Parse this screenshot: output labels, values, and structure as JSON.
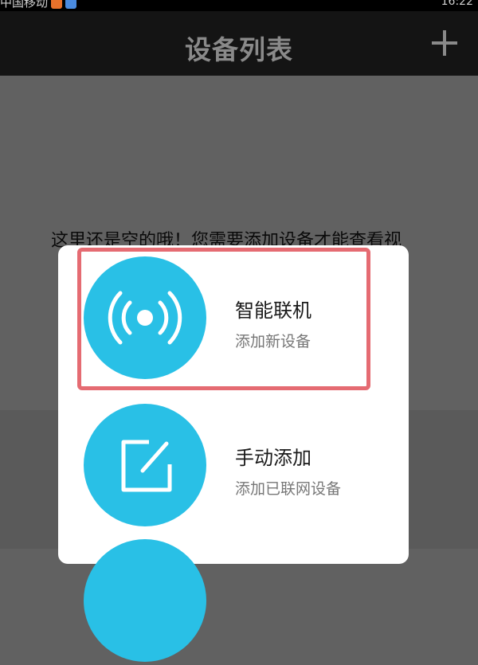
{
  "status_bar": {
    "left_text": "中国移动",
    "right_text": "16:22"
  },
  "header": {
    "title": "设备列表",
    "add_button": "plus-icon"
  },
  "main": {
    "empty_message": "这里还是空的哦！您需要添加设备才能查看视"
  },
  "dialog": {
    "options": [
      {
        "title": "智能联机",
        "subtitle": "添加新设备",
        "icon": "wireless-signal-icon"
      },
      {
        "title": "手动添加",
        "subtitle": "添加已联网设备",
        "icon": "edit-icon"
      },
      {
        "title": "",
        "subtitle": "",
        "icon": "circle-icon"
      }
    ]
  },
  "colors": {
    "accent": "#29c0e6",
    "highlight": "#e56b72"
  }
}
